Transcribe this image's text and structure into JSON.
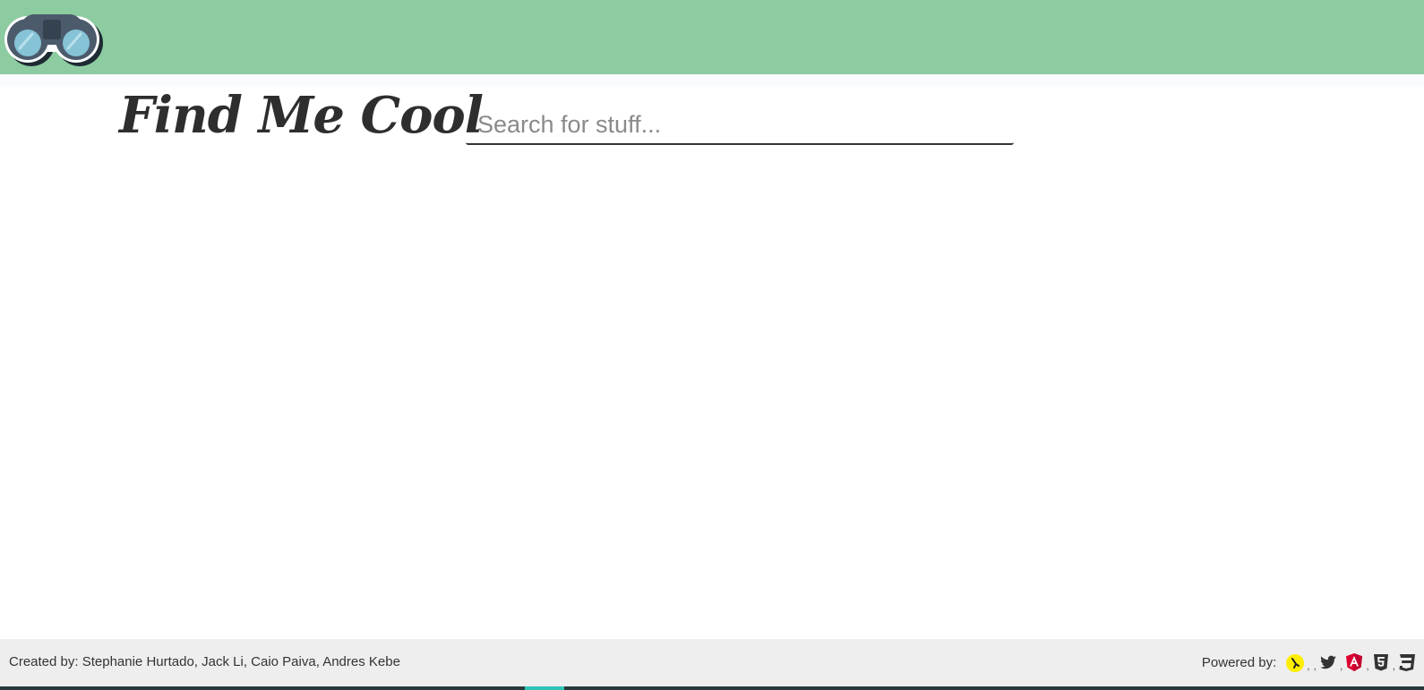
{
  "header": {
    "logo_icon": "binoculars-icon",
    "background_color": "#8dcba1"
  },
  "brand": {
    "title": "Find Me Cool"
  },
  "search": {
    "placeholder": "Search for stuff...",
    "value": ""
  },
  "footer": {
    "credits_label": "Created by:",
    "authors": "Stephanie Hurtado, Jack Li, Caio Paiva, Andres Kebe",
    "powered_label": "Powered by:",
    "separator": ",",
    "powered_icons": [
      "yelp-icon",
      "twitter-icon",
      "angular-icon",
      "html5-icon",
      "css3-icon"
    ]
  }
}
